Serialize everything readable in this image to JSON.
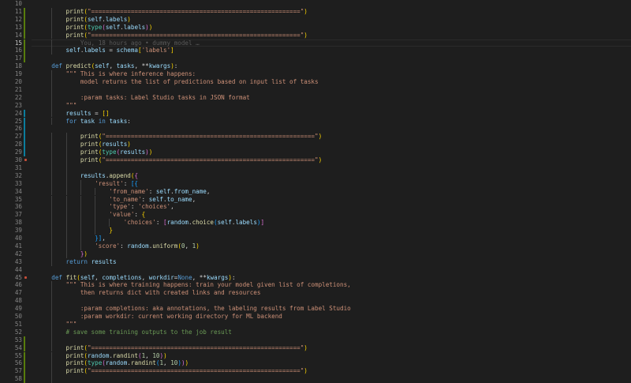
{
  "editor": {
    "blame": "You, 18 hours ago • dummy model …",
    "lines": [
      {
        "n": "10",
        "t": []
      },
      {
        "n": "11",
        "t": [
          [
            "f",
            "print"
          ],
          [
            "y",
            "("
          ],
          [
            "s",
            "\"==========================================================\""
          ],
          [
            "y",
            ")"
          ]
        ],
        "i": 2,
        "mk": "added"
      },
      {
        "n": "12",
        "t": [
          [
            "f",
            "print"
          ],
          [
            "y",
            "("
          ],
          [
            "v",
            "self"
          ],
          [
            "p",
            "."
          ],
          [
            "v",
            "labels"
          ],
          [
            "y",
            ")"
          ]
        ],
        "i": 2,
        "mk": "added"
      },
      {
        "n": "13",
        "t": [
          [
            "f",
            "print"
          ],
          [
            "y",
            "("
          ],
          [
            "b",
            "type"
          ],
          [
            "m",
            "("
          ],
          [
            "v",
            "self"
          ],
          [
            "p",
            "."
          ],
          [
            "v",
            "labels"
          ],
          [
            "m",
            ")"
          ],
          [
            "y",
            ")"
          ]
        ],
        "i": 2,
        "mk": "added"
      },
      {
        "n": "14",
        "t": [
          [
            "f",
            "print"
          ],
          [
            "y",
            "("
          ],
          [
            "s",
            "\"==========================================================\""
          ],
          [
            "y",
            ")"
          ]
        ],
        "i": 2,
        "mk": "added"
      },
      {
        "n": "15",
        "t": [],
        "i": 2,
        "mk": "added",
        "blame": true,
        "active": true
      },
      {
        "n": "16",
        "t": [
          [
            "v",
            "self"
          ],
          [
            "p",
            "."
          ],
          [
            "v",
            "labels"
          ],
          [
            "p",
            " = "
          ],
          [
            "v",
            "schema"
          ],
          [
            "y",
            "["
          ],
          [
            "s",
            "'labels'"
          ],
          [
            "y",
            "]"
          ]
        ],
        "i": 2,
        "mk": "added"
      },
      {
        "n": "17",
        "t": [],
        "mk": "added"
      },
      {
        "n": "18",
        "t": [
          [
            "k",
            "def "
          ],
          [
            "f",
            "predict"
          ],
          [
            "y",
            "("
          ],
          [
            "v",
            "self"
          ],
          [
            "p",
            ", "
          ],
          [
            "v",
            "tasks"
          ],
          [
            "p",
            ", **"
          ],
          [
            "v",
            "kwargs"
          ],
          [
            "y",
            ")"
          ],
          [
            "p",
            ":"
          ]
        ],
        "i": 1
      },
      {
        "n": "19",
        "t": [
          [
            "s",
            "\"\"\" This is where inference happens:"
          ]
        ],
        "i": 2
      },
      {
        "n": "20",
        "t": [
          [
            "s",
            "    model returns the list of predictions based on input list of tasks"
          ]
        ],
        "i": 2
      },
      {
        "n": "21",
        "t": [],
        "i": 2
      },
      {
        "n": "22",
        "t": [
          [
            "s",
            "    :param tasks: Label Studio tasks in JSON format"
          ]
        ],
        "i": 2
      },
      {
        "n": "23",
        "t": [
          [
            "s",
            "\"\"\""
          ]
        ],
        "i": 2
      },
      {
        "n": "24",
        "t": [
          [
            "v",
            "results"
          ],
          [
            "p",
            " = "
          ],
          [
            "y",
            "[]"
          ]
        ],
        "i": 2,
        "mk": "modified"
      },
      {
        "n": "25",
        "t": [
          [
            "k",
            "for "
          ],
          [
            "v",
            "task"
          ],
          [
            "k",
            " in "
          ],
          [
            "v",
            "tasks"
          ],
          [
            "p",
            ":"
          ]
        ],
        "i": 2,
        "mk": "modified"
      },
      {
        "n": "26",
        "t": [],
        "mk": "modified"
      },
      {
        "n": "27",
        "t": [
          [
            "f",
            "print"
          ],
          [
            "y",
            "("
          ],
          [
            "s",
            "\"==========================================================\""
          ],
          [
            "y",
            ")"
          ]
        ],
        "i": 3,
        "mk": "modified"
      },
      {
        "n": "28",
        "t": [
          [
            "f",
            "print"
          ],
          [
            "y",
            "("
          ],
          [
            "v",
            "results"
          ],
          [
            "y",
            ")"
          ]
        ],
        "i": 3,
        "mk": "modified"
      },
      {
        "n": "29",
        "t": [
          [
            "f",
            "print"
          ],
          [
            "y",
            "("
          ],
          [
            "b",
            "type"
          ],
          [
            "m",
            "("
          ],
          [
            "v",
            "results"
          ],
          [
            "m",
            ")"
          ],
          [
            "y",
            ")"
          ]
        ],
        "i": 3,
        "mk": "modified"
      },
      {
        "n": "30",
        "t": [
          [
            "f",
            "print"
          ],
          [
            "y",
            "("
          ],
          [
            "s",
            "\"==========================================================\""
          ],
          [
            "y",
            ")"
          ]
        ],
        "i": 3,
        "dot": true
      },
      {
        "n": "31",
        "t": [],
        "i": 3
      },
      {
        "n": "32",
        "t": [
          [
            "v",
            "results"
          ],
          [
            "p",
            "."
          ],
          [
            "f",
            "append"
          ],
          [
            "y",
            "("
          ],
          [
            "m",
            "{"
          ]
        ],
        "i": 3
      },
      {
        "n": "33",
        "t": [
          [
            "s",
            "'result'"
          ],
          [
            "p",
            ": "
          ],
          [
            "bl",
            "[{"
          ]
        ],
        "i": 4
      },
      {
        "n": "34",
        "t": [
          [
            "s",
            "'from_name'"
          ],
          [
            "p",
            ": "
          ],
          [
            "v",
            "self"
          ],
          [
            "p",
            "."
          ],
          [
            "v",
            "from_name"
          ],
          [
            "p",
            ","
          ]
        ],
        "i": 5
      },
      {
        "n": "35",
        "t": [
          [
            "s",
            "'to_name'"
          ],
          [
            "p",
            ": "
          ],
          [
            "v",
            "self"
          ],
          [
            "p",
            "."
          ],
          [
            "v",
            "to_name"
          ],
          [
            "p",
            ","
          ]
        ],
        "i": 5
      },
      {
        "n": "36",
        "t": [
          [
            "s",
            "'type'"
          ],
          [
            "p",
            ": "
          ],
          [
            "s",
            "'choices'"
          ],
          [
            "p",
            ","
          ]
        ],
        "i": 5
      },
      {
        "n": "37",
        "t": [
          [
            "s",
            "'value'"
          ],
          [
            "p",
            ": "
          ],
          [
            "y",
            "{"
          ]
        ],
        "i": 5
      },
      {
        "n": "38",
        "t": [
          [
            "s",
            "'choices'"
          ],
          [
            "p",
            ": "
          ],
          [
            "m",
            "["
          ],
          [
            "v",
            "random"
          ],
          [
            "p",
            "."
          ],
          [
            "f",
            "choice"
          ],
          [
            "bl",
            "("
          ],
          [
            "v",
            "self"
          ],
          [
            "p",
            "."
          ],
          [
            "v",
            "labels"
          ],
          [
            "bl",
            ")"
          ],
          [
            "m",
            "]"
          ]
        ],
        "i": 6
      },
      {
        "n": "39",
        "t": [
          [
            "y",
            "}"
          ]
        ],
        "i": 5
      },
      {
        "n": "40",
        "t": [
          [
            "bl",
            "}]"
          ],
          [
            "p",
            ","
          ]
        ],
        "i": 4
      },
      {
        "n": "41",
        "t": [
          [
            "s",
            "'score'"
          ],
          [
            "p",
            ": "
          ],
          [
            "v",
            "random"
          ],
          [
            "p",
            "."
          ],
          [
            "f",
            "uniform"
          ],
          [
            "y",
            "("
          ],
          [
            "n",
            "0"
          ],
          [
            "p",
            ", "
          ],
          [
            "n",
            "1"
          ],
          [
            "y",
            ")"
          ]
        ],
        "i": 4
      },
      {
        "n": "42",
        "t": [
          [
            "m",
            "}"
          ],
          [
            "y",
            ")"
          ]
        ],
        "i": 3
      },
      {
        "n": "43",
        "t": [
          [
            "k",
            "return "
          ],
          [
            "v",
            "results"
          ]
        ],
        "i": 2
      },
      {
        "n": "44",
        "t": []
      },
      {
        "n": "45",
        "t": [
          [
            "k",
            "def "
          ],
          [
            "f",
            "fit"
          ],
          [
            "y",
            "("
          ],
          [
            "v",
            "self"
          ],
          [
            "p",
            ", "
          ],
          [
            "v",
            "completions"
          ],
          [
            "p",
            ", "
          ],
          [
            "v",
            "workdir"
          ],
          [
            "p",
            "="
          ],
          [
            "k",
            "None"
          ],
          [
            "p",
            ", **"
          ],
          [
            "v",
            "kwargs"
          ],
          [
            "y",
            ")"
          ],
          [
            "p",
            ":"
          ]
        ],
        "i": 1,
        "dot": true
      },
      {
        "n": "46",
        "t": [
          [
            "s",
            "\"\"\" This is where training happens: train your model given list of completions,"
          ]
        ],
        "i": 2
      },
      {
        "n": "47",
        "t": [
          [
            "s",
            "    then returns dict with created links and resources"
          ]
        ],
        "i": 2
      },
      {
        "n": "48",
        "t": [],
        "i": 2
      },
      {
        "n": "49",
        "t": [
          [
            "s",
            "    :param completions: aka annotations, the labeling results from Label Studio"
          ]
        ],
        "i": 2
      },
      {
        "n": "50",
        "t": [
          [
            "s",
            "    :param workdir: current working directory for ML backend"
          ]
        ],
        "i": 2
      },
      {
        "n": "51",
        "t": [
          [
            "s",
            "\"\"\""
          ]
        ],
        "i": 2
      },
      {
        "n": "52",
        "t": [
          [
            "c",
            "# save some training outputs to the job result"
          ]
        ],
        "i": 2
      },
      {
        "n": "53",
        "t": [],
        "i": 2,
        "mk": "added"
      },
      {
        "n": "54",
        "t": [
          [
            "f",
            "print"
          ],
          [
            "y",
            "("
          ],
          [
            "s",
            "\"==========================================================\""
          ],
          [
            "y",
            ")"
          ]
        ],
        "i": 2,
        "mk": "added"
      },
      {
        "n": "55",
        "t": [
          [
            "f",
            "print"
          ],
          [
            "y",
            "("
          ],
          [
            "v",
            "random"
          ],
          [
            "p",
            "."
          ],
          [
            "f",
            "randint"
          ],
          [
            "m",
            "("
          ],
          [
            "n",
            "1"
          ],
          [
            "p",
            ", "
          ],
          [
            "n",
            "10"
          ],
          [
            "m",
            ")"
          ],
          [
            "y",
            ")"
          ]
        ],
        "i": 2,
        "mk": "added"
      },
      {
        "n": "56",
        "t": [
          [
            "f",
            "print"
          ],
          [
            "y",
            "("
          ],
          [
            "b",
            "type"
          ],
          [
            "m",
            "("
          ],
          [
            "v",
            "random"
          ],
          [
            "p",
            "."
          ],
          [
            "f",
            "randint"
          ],
          [
            "bl",
            "("
          ],
          [
            "n",
            "1"
          ],
          [
            "p",
            ", "
          ],
          [
            "n",
            "10"
          ],
          [
            "bl",
            ")"
          ],
          [
            "m",
            ")"
          ],
          [
            "y",
            ")"
          ]
        ],
        "i": 2,
        "mk": "added"
      },
      {
        "n": "57",
        "t": [
          [
            "f",
            "print"
          ],
          [
            "y",
            "("
          ],
          [
            "s",
            "\"==========================================================\""
          ],
          [
            "y",
            ")"
          ]
        ],
        "i": 2,
        "mk": "added"
      },
      {
        "n": "58",
        "t": [],
        "i": 2,
        "mk": "added"
      }
    ]
  }
}
